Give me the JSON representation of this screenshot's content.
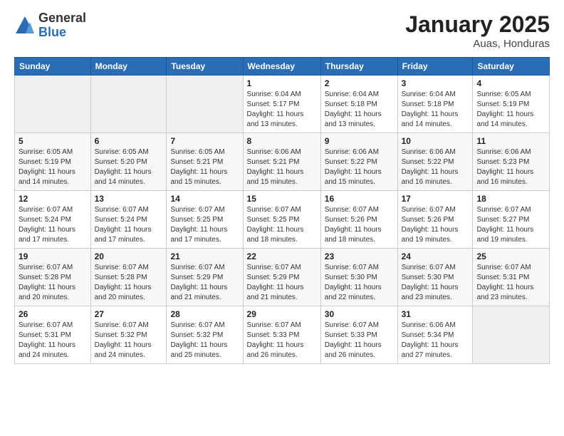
{
  "header": {
    "logo_general": "General",
    "logo_blue": "Blue",
    "month_title": "January 2025",
    "location": "Auas, Honduras"
  },
  "weekdays": [
    "Sunday",
    "Monday",
    "Tuesday",
    "Wednesday",
    "Thursday",
    "Friday",
    "Saturday"
  ],
  "weeks": [
    [
      {
        "day": "",
        "info": ""
      },
      {
        "day": "",
        "info": ""
      },
      {
        "day": "",
        "info": ""
      },
      {
        "day": "1",
        "info": "Sunrise: 6:04 AM\nSunset: 5:17 PM\nDaylight: 11 hours\nand 13 minutes."
      },
      {
        "day": "2",
        "info": "Sunrise: 6:04 AM\nSunset: 5:18 PM\nDaylight: 11 hours\nand 13 minutes."
      },
      {
        "day": "3",
        "info": "Sunrise: 6:04 AM\nSunset: 5:18 PM\nDaylight: 11 hours\nand 14 minutes."
      },
      {
        "day": "4",
        "info": "Sunrise: 6:05 AM\nSunset: 5:19 PM\nDaylight: 11 hours\nand 14 minutes."
      }
    ],
    [
      {
        "day": "5",
        "info": "Sunrise: 6:05 AM\nSunset: 5:19 PM\nDaylight: 11 hours\nand 14 minutes."
      },
      {
        "day": "6",
        "info": "Sunrise: 6:05 AM\nSunset: 5:20 PM\nDaylight: 11 hours\nand 14 minutes."
      },
      {
        "day": "7",
        "info": "Sunrise: 6:05 AM\nSunset: 5:21 PM\nDaylight: 11 hours\nand 15 minutes."
      },
      {
        "day": "8",
        "info": "Sunrise: 6:06 AM\nSunset: 5:21 PM\nDaylight: 11 hours\nand 15 minutes."
      },
      {
        "day": "9",
        "info": "Sunrise: 6:06 AM\nSunset: 5:22 PM\nDaylight: 11 hours\nand 15 minutes."
      },
      {
        "day": "10",
        "info": "Sunrise: 6:06 AM\nSunset: 5:22 PM\nDaylight: 11 hours\nand 16 minutes."
      },
      {
        "day": "11",
        "info": "Sunrise: 6:06 AM\nSunset: 5:23 PM\nDaylight: 11 hours\nand 16 minutes."
      }
    ],
    [
      {
        "day": "12",
        "info": "Sunrise: 6:07 AM\nSunset: 5:24 PM\nDaylight: 11 hours\nand 17 minutes."
      },
      {
        "day": "13",
        "info": "Sunrise: 6:07 AM\nSunset: 5:24 PM\nDaylight: 11 hours\nand 17 minutes."
      },
      {
        "day": "14",
        "info": "Sunrise: 6:07 AM\nSunset: 5:25 PM\nDaylight: 11 hours\nand 17 minutes."
      },
      {
        "day": "15",
        "info": "Sunrise: 6:07 AM\nSunset: 5:25 PM\nDaylight: 11 hours\nand 18 minutes."
      },
      {
        "day": "16",
        "info": "Sunrise: 6:07 AM\nSunset: 5:26 PM\nDaylight: 11 hours\nand 18 minutes."
      },
      {
        "day": "17",
        "info": "Sunrise: 6:07 AM\nSunset: 5:26 PM\nDaylight: 11 hours\nand 19 minutes."
      },
      {
        "day": "18",
        "info": "Sunrise: 6:07 AM\nSunset: 5:27 PM\nDaylight: 11 hours\nand 19 minutes."
      }
    ],
    [
      {
        "day": "19",
        "info": "Sunrise: 6:07 AM\nSunset: 5:28 PM\nDaylight: 11 hours\nand 20 minutes."
      },
      {
        "day": "20",
        "info": "Sunrise: 6:07 AM\nSunset: 5:28 PM\nDaylight: 11 hours\nand 20 minutes."
      },
      {
        "day": "21",
        "info": "Sunrise: 6:07 AM\nSunset: 5:29 PM\nDaylight: 11 hours\nand 21 minutes."
      },
      {
        "day": "22",
        "info": "Sunrise: 6:07 AM\nSunset: 5:29 PM\nDaylight: 11 hours\nand 21 minutes."
      },
      {
        "day": "23",
        "info": "Sunrise: 6:07 AM\nSunset: 5:30 PM\nDaylight: 11 hours\nand 22 minutes."
      },
      {
        "day": "24",
        "info": "Sunrise: 6:07 AM\nSunset: 5:30 PM\nDaylight: 11 hours\nand 23 minutes."
      },
      {
        "day": "25",
        "info": "Sunrise: 6:07 AM\nSunset: 5:31 PM\nDaylight: 11 hours\nand 23 minutes."
      }
    ],
    [
      {
        "day": "26",
        "info": "Sunrise: 6:07 AM\nSunset: 5:31 PM\nDaylight: 11 hours\nand 24 minutes."
      },
      {
        "day": "27",
        "info": "Sunrise: 6:07 AM\nSunset: 5:32 PM\nDaylight: 11 hours\nand 24 minutes."
      },
      {
        "day": "28",
        "info": "Sunrise: 6:07 AM\nSunset: 5:32 PM\nDaylight: 11 hours\nand 25 minutes."
      },
      {
        "day": "29",
        "info": "Sunrise: 6:07 AM\nSunset: 5:33 PM\nDaylight: 11 hours\nand 26 minutes."
      },
      {
        "day": "30",
        "info": "Sunrise: 6:07 AM\nSunset: 5:33 PM\nDaylight: 11 hours\nand 26 minutes."
      },
      {
        "day": "31",
        "info": "Sunrise: 6:06 AM\nSunset: 5:34 PM\nDaylight: 11 hours\nand 27 minutes."
      },
      {
        "day": "",
        "info": ""
      }
    ]
  ]
}
